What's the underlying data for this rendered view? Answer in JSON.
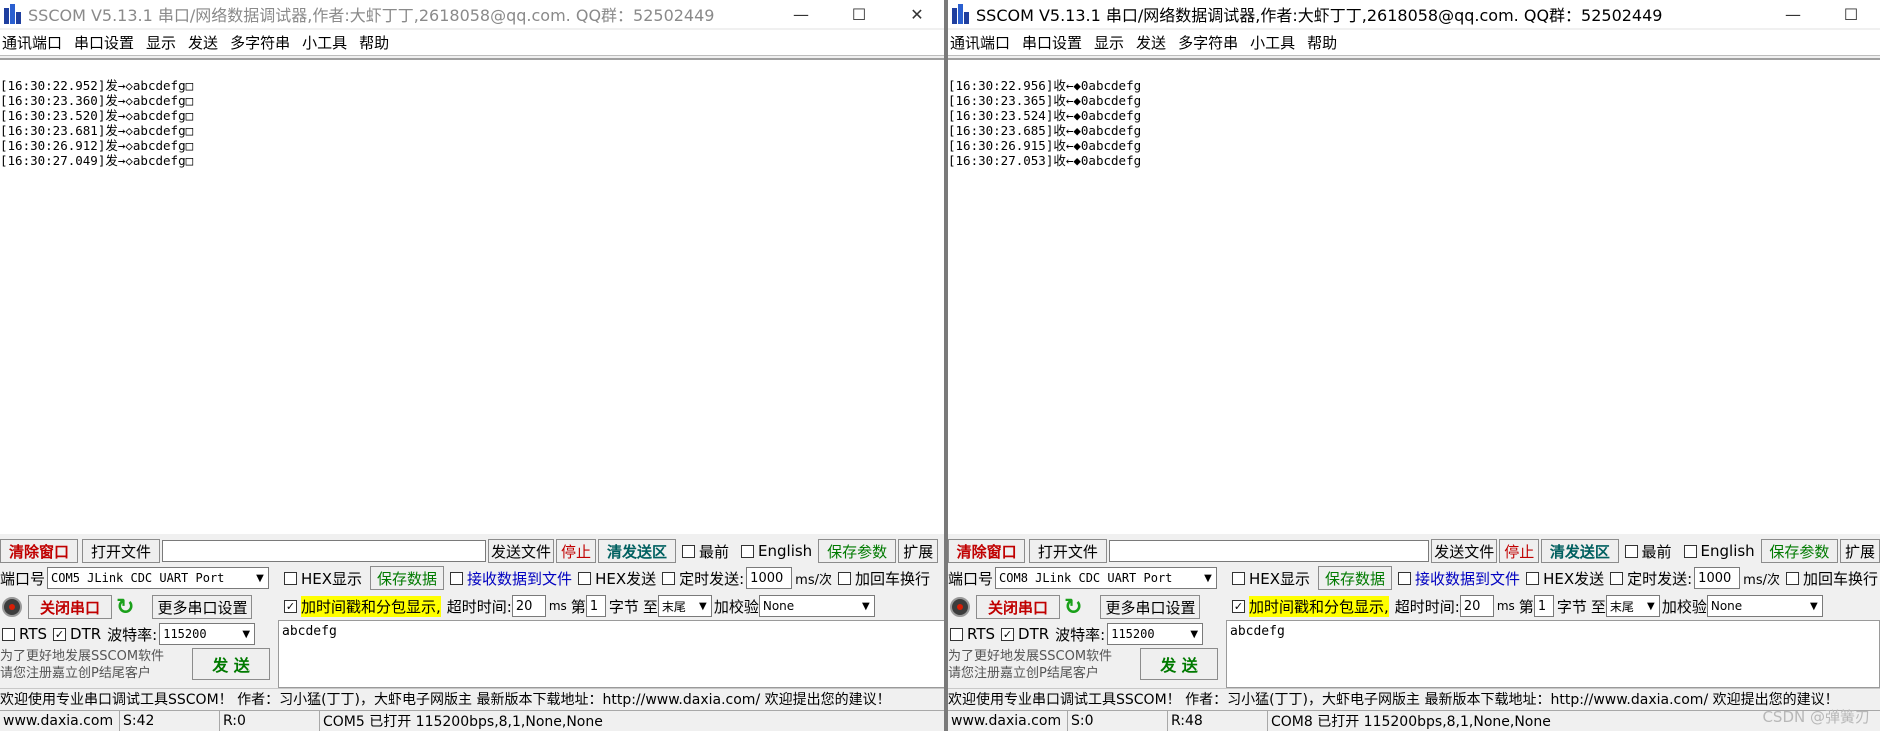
{
  "left": {
    "title": "SSCOM V5.13.1 串口/网络数据调试器,作者:大虾丁丁,2618058@qq.com. QQ群：52502449",
    "menu": [
      "通讯端口",
      "串口设置",
      "显示",
      "发送",
      "多字符串",
      "小工具",
      "帮助"
    ],
    "log": [
      "[16:30:22.952]发→◇abcdefg□",
      "[16:30:23.360]发→◇abcdefg□",
      "[16:30:23.520]发→◇abcdefg□",
      "[16:30:23.681]发→◇abcdefg□",
      "[16:30:26.912]发→◇abcdefg□",
      "[16:30:27.049]发→◇abcdefg□"
    ],
    "port_value": "COM5 JLink CDC UART Port",
    "send_text": "abcdefg",
    "status": {
      "website": "www.daxia.com",
      "sent": "S:42",
      "received": "R:0",
      "port_info": "COM5 已打开  115200bps,8,1,None,None"
    }
  },
  "right": {
    "title": "SSCOM V5.13.1 串口/网络数据调试器,作者:大虾丁丁,2618058@qq.com. QQ群：52502449",
    "menu": [
      "通讯端口",
      "串口设置",
      "显示",
      "发送",
      "多字符串",
      "小工具",
      "帮助"
    ],
    "log": [
      "[16:30:22.956]收←◆0abcdefg",
      "[16:30:23.365]收←◆0abcdefg",
      "[16:30:23.524]收←◆0abcdefg",
      "[16:30:23.685]收←◆0abcdefg",
      "[16:30:26.915]收←◆0abcdefg",
      "[16:30:27.053]收←◆0abcdefg"
    ],
    "port_value": "COM8 JLink CDC UART Port",
    "send_text": "abcdefg",
    "status": {
      "website": "www.daxia.com",
      "sent": "S:0",
      "received": "R:48",
      "port_info": "COM8 已打开  115200bps,8,1,None,None"
    }
  },
  "common": {
    "win_min": "—",
    "win_max": "☐",
    "win_close": "✕",
    "clear_window": "清除窗口",
    "open_file": "打开文件",
    "send_file": "发送文件",
    "stop": "停止",
    "clear_send": "清发送区",
    "latest": "最前",
    "english": "English",
    "save_params": "保存参数",
    "expand": "扩展",
    "port_label": "端口号",
    "hex_display": "HEX显示",
    "save_data": "保存数据",
    "recv_to_file": "接收数据到文件",
    "hex_send": "HEX发送",
    "timed_send": "定时发送:",
    "interval": "1000",
    "interval_unit": "ms/次",
    "append_crlf": "加回车换行",
    "close_port": "关闭串口",
    "more_settings": "更多串口设置",
    "timestamp_label": "加时间戳和分包显示,",
    "timeout_label": "超时时间:",
    "timeout": "20",
    "ms": "ms",
    "nth": "第",
    "byte_index": "1",
    "byte_label": "字节",
    "to_label": "至",
    "tail": "末尾",
    "checksum_label": "加校验",
    "checksum": "None",
    "rts": "RTS",
    "dtr": "DTR",
    "baud_label": "波特率:",
    "baud": "115200",
    "promo_line1": "为了更好地发展SSCOM软件",
    "promo_line2": "请您注册嘉立创P结尾客户",
    "send": "发 送",
    "ticker": "欢迎使用专业串口调试工具SSCOM！  作者：习小猛(丁丁)，大虾电子网版主  最新版本下载地址：http://www.daxia.com/  欢迎提出您的建议！",
    "watermark": "CSDN @弹簧刃"
  },
  "colors": {
    "accent_red": "#c00000",
    "accent_green": "#007a00",
    "accent_blue": "#0000c0",
    "highlight": "#ffff00"
  }
}
